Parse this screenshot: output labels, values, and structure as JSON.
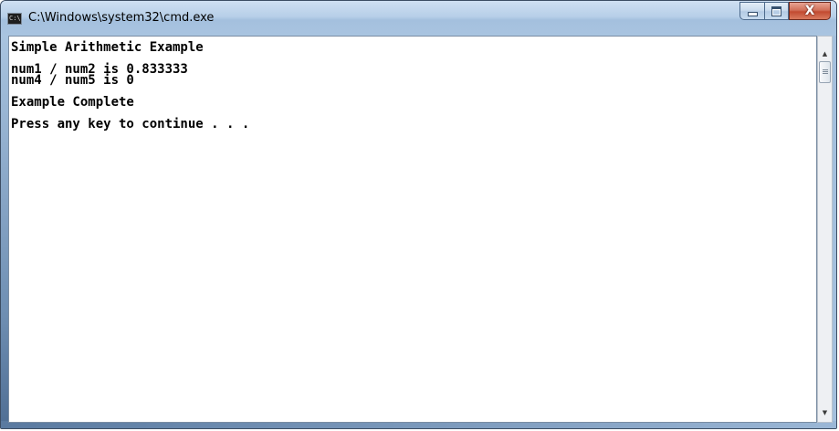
{
  "window": {
    "title": "C:\\Windows\\system32\\cmd.exe",
    "icon": "cmd-icon",
    "icon_text": "C:\\",
    "buttons": {
      "minimize": "minimize-icon",
      "maximize": "maximize-icon",
      "close": "close-icon",
      "close_glyph": "X"
    }
  },
  "console": {
    "lines": [
      "Simple Arithmetic Example",
      "",
      "num1 / num2 is 0.833333",
      "num4 / num5 is 0",
      "",
      "Example Complete",
      "",
      "Press any key to continue . . ."
    ],
    "background": "#ffffff",
    "foreground": "#000000"
  },
  "scrollbar": {
    "up_arrow": "▲",
    "down_arrow": "▼"
  },
  "colors": {
    "titlebar": "#b7cfe8",
    "close_button": "#c24b31"
  }
}
